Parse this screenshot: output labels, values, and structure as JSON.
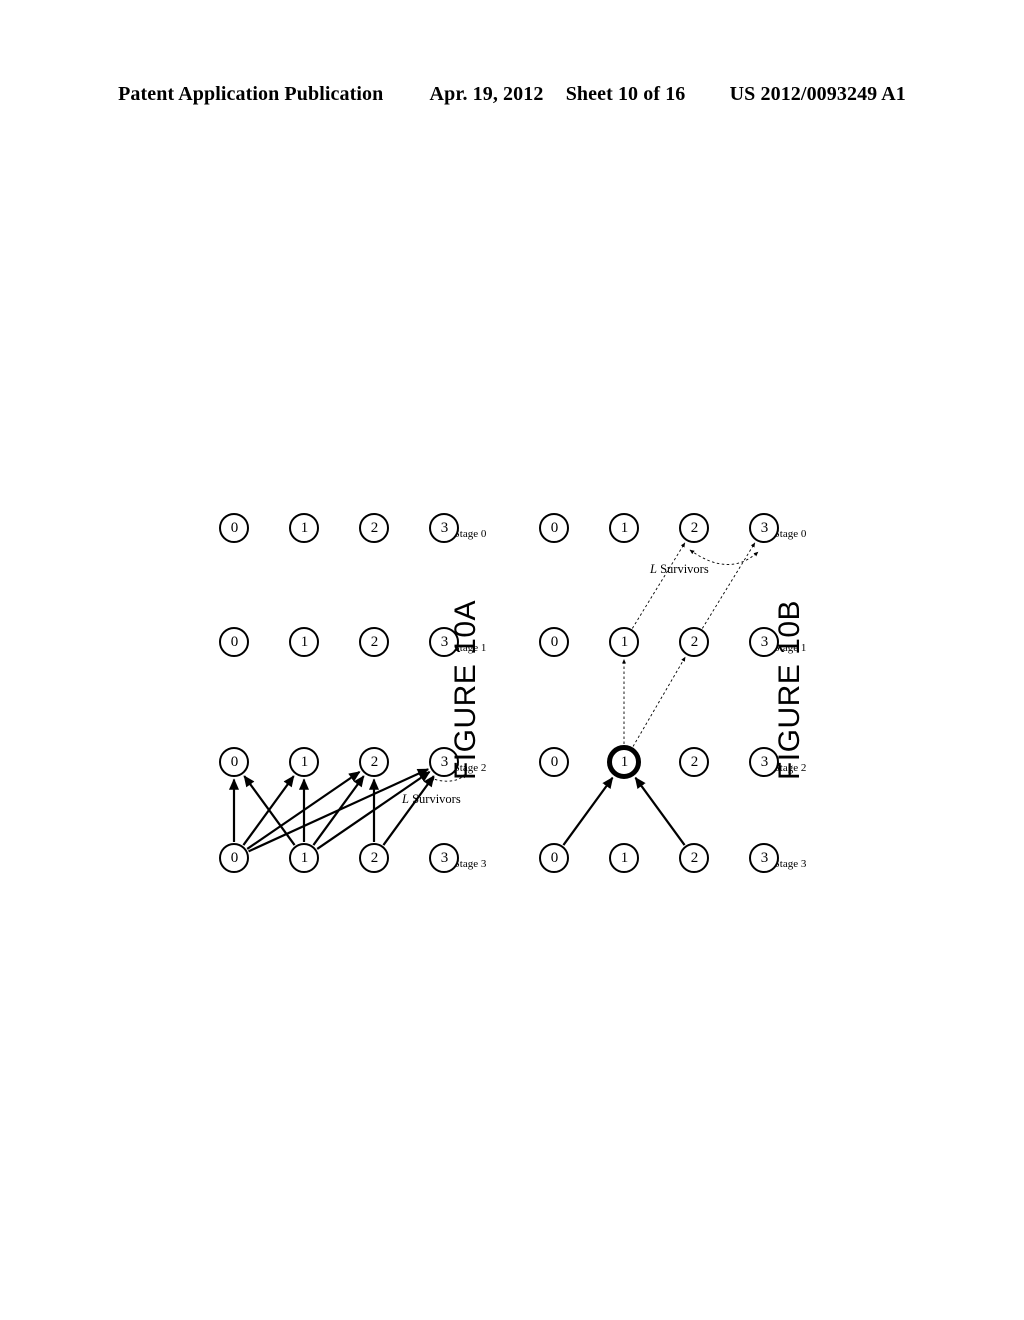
{
  "header": {
    "publication": "Patent Application Publication",
    "date": "Apr. 19, 2012",
    "sheet": "Sheet 10 of 16",
    "pub_number": "US 2012/0093249 A1"
  },
  "figures": [
    {
      "id": "fig-10a",
      "caption": "FIGURE 10A",
      "survivors_label_prefix": "L",
      "survivors_label_text": " Survivors",
      "stage_labels": [
        "Stage 0",
        "Stage 1",
        "Stage 2",
        "Stage 3"
      ],
      "node_labels": [
        "0",
        "1",
        "2",
        "3"
      ],
      "bold_node": null,
      "solid_edges": [
        {
          "from_stage": 3,
          "from_node": 0,
          "to_stage": 2,
          "to_node": 0
        },
        {
          "from_stage": 3,
          "from_node": 0,
          "to_stage": 2,
          "to_node": 1
        },
        {
          "from_stage": 3,
          "from_node": 0,
          "to_stage": 2,
          "to_node": 2
        },
        {
          "from_stage": 3,
          "from_node": 0,
          "to_stage": 2,
          "to_node": 3
        },
        {
          "from_stage": 3,
          "from_node": 1,
          "to_stage": 2,
          "to_node": 0
        },
        {
          "from_stage": 3,
          "from_node": 1,
          "to_stage": 2,
          "to_node": 1
        },
        {
          "from_stage": 3,
          "from_node": 1,
          "to_stage": 2,
          "to_node": 2
        },
        {
          "from_stage": 3,
          "from_node": 1,
          "to_stage": 2,
          "to_node": 3
        },
        {
          "from_stage": 3,
          "from_node": 2,
          "to_stage": 2,
          "to_node": 2
        },
        {
          "from_stage": 3,
          "from_node": 2,
          "to_stage": 2,
          "to_node": 3
        }
      ],
      "dashed_edges": []
    },
    {
      "id": "fig-10b",
      "caption": "FIGURE 10B",
      "survivors_label_prefix": "L",
      "survivors_label_text": " Survivors",
      "stage_labels": [
        "Stage 0",
        "Stage 1",
        "Stage 2",
        "Stage 3"
      ],
      "node_labels": [
        "0",
        "1",
        "2",
        "3"
      ],
      "bold_node": {
        "stage": 2,
        "node": 1
      },
      "solid_edges": [
        {
          "from_stage": 3,
          "from_node": 0,
          "to_stage": 2,
          "to_node": 1
        },
        {
          "from_stage": 3,
          "from_node": 2,
          "to_stage": 2,
          "to_node": 1
        }
      ],
      "dashed_edges": [
        {
          "from_stage": 2,
          "from_node": 1,
          "to_stage": 1,
          "to_node": 1
        },
        {
          "from_stage": 2,
          "from_node": 1,
          "to_stage": 1,
          "to_node": 2
        },
        {
          "from_stage": 1,
          "from_node": 1,
          "to_stage": 0,
          "to_node": 2
        },
        {
          "from_stage": 1,
          "from_node": 2,
          "to_stage": 0,
          "to_node": 3
        }
      ]
    }
  ]
}
